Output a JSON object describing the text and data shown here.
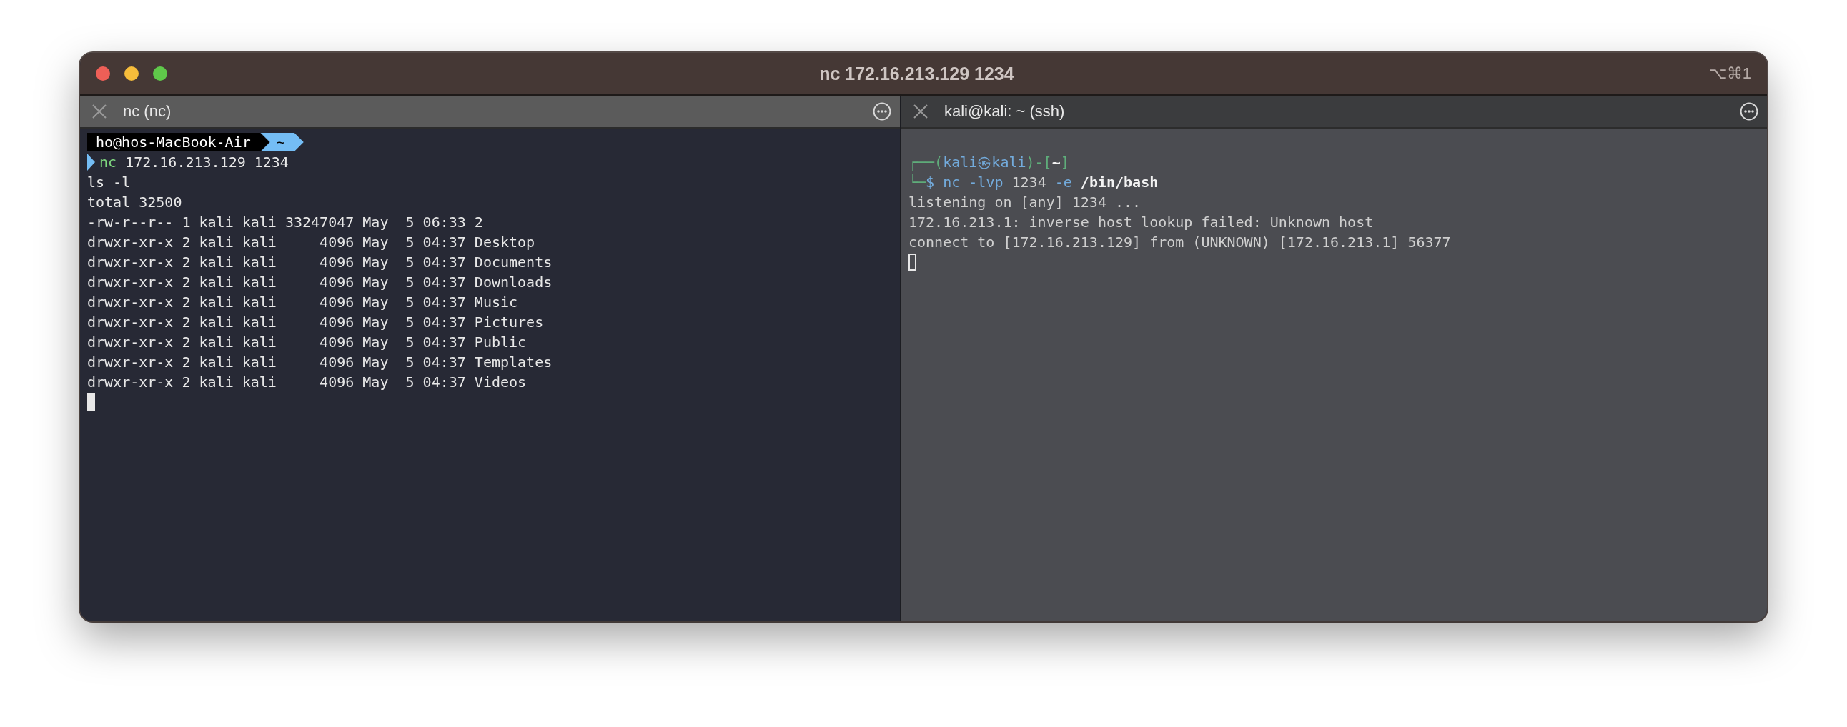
{
  "window": {
    "title": "nc 172.16.213.129 1234",
    "shortcut": "⌥⌘1"
  },
  "panes": [
    {
      "tab_title": "nc (nc)",
      "focused": true,
      "lines": [
        {
          "kind": "powerline",
          "segments": [
            {
              "text": "ho@hos-MacBook-Air",
              "kind": "user"
            },
            {
              "text": "~",
              "kind": "dir"
            }
          ]
        },
        {
          "kind": "command",
          "segments": [
            {
              "text": "nc",
              "kind": "cmd"
            },
            {
              "text": " 172.16.213.129 1234",
              "kind": "plain"
            }
          ]
        },
        {
          "kind": "output",
          "text": "ls -l"
        },
        {
          "kind": "output",
          "text": "total 32500"
        },
        {
          "kind": "output",
          "text": "-rw-r--r-- 1 kali kali 33247047 May  5 06:33 2"
        },
        {
          "kind": "output",
          "text": "drwxr-xr-x 2 kali kali     4096 May  5 04:37 Desktop"
        },
        {
          "kind": "output",
          "text": "drwxr-xr-x 2 kali kali     4096 May  5 04:37 Documents"
        },
        {
          "kind": "output",
          "text": "drwxr-xr-x 2 kali kali     4096 May  5 04:37 Downloads"
        },
        {
          "kind": "output",
          "text": "drwxr-xr-x 2 kali kali     4096 May  5 04:37 Music"
        },
        {
          "kind": "output",
          "text": "drwxr-xr-x 2 kali kali     4096 May  5 04:37 Pictures"
        },
        {
          "kind": "output",
          "text": "drwxr-xr-x 2 kali kali     4096 May  5 04:37 Public"
        },
        {
          "kind": "output",
          "text": "drwxr-xr-x 2 kali kali     4096 May  5 04:37 Templates"
        },
        {
          "kind": "output",
          "text": "drwxr-xr-x 2 kali kali     4096 May  5 04:37 Videos"
        },
        {
          "kind": "cursor"
        }
      ]
    },
    {
      "tab_title": "kali@kali: ~ (ssh)",
      "focused": false,
      "lines": [
        {
          "kind": "blank"
        },
        {
          "kind": "rich",
          "segments": [
            {
              "text": "┌──(",
              "kind": "frame"
            },
            {
              "text": "kali㉿kali",
              "kind": "host"
            },
            {
              "text": ")-[",
              "kind": "frame"
            },
            {
              "text": "~",
              "kind": "bold"
            },
            {
              "text": "]",
              "kind": "frame"
            }
          ]
        },
        {
          "kind": "rich",
          "segments": [
            {
              "text": "└─",
              "kind": "frame"
            },
            {
              "text": "$ nc -lvp",
              "kind": "host"
            },
            {
              "text": " 1234 ",
              "kind": "plain"
            },
            {
              "text": "-e",
              "kind": "host"
            },
            {
              "text": " /bin/bash",
              "kind": "bold"
            }
          ]
        },
        {
          "kind": "output",
          "text": "listening on [any] 1234 ..."
        },
        {
          "kind": "output",
          "text": "172.16.213.1: inverse host lookup failed: Unknown host"
        },
        {
          "kind": "output",
          "text": "connect to [172.16.213.129] from (UNKNOWN) [172.16.213.1] 56377"
        },
        {
          "kind": "cursor"
        }
      ]
    }
  ]
}
